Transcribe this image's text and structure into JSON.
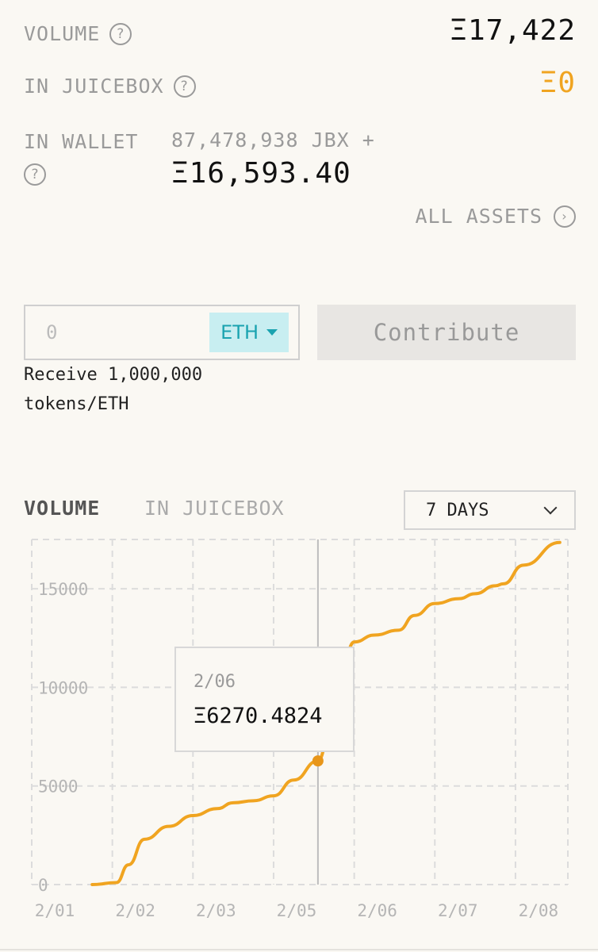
{
  "stats": {
    "volume_label": "VOLUME",
    "volume_value": "Ξ17,422",
    "in_juicebox_label": "IN JUICEBOX",
    "in_juicebox_value": "Ξ0",
    "in_wallet_label": "IN WALLET",
    "in_wallet_tokens": "87,478,938 JBX +",
    "in_wallet_eth": "Ξ16,593.40",
    "all_assets_label": "ALL ASSETS"
  },
  "pay": {
    "amount_placeholder": "0",
    "currency": "ETH",
    "contribute_label": "Contribute",
    "receive_line1": "Receive 1,000,000",
    "receive_line2": "tokens/ETH"
  },
  "chart_tabs": {
    "volume": "VOLUME",
    "in_juicebox": "IN JUICEBOX",
    "range": "7 DAYS"
  },
  "tooltip": {
    "date": "2/06",
    "value": "Ξ6270.4824"
  },
  "colors": {
    "accent_orange": "#f0a420",
    "accent_teal": "#1aa3b0"
  },
  "chart_data": {
    "type": "line",
    "title": "",
    "xlabel": "",
    "ylabel": "",
    "y_ticks": [
      0,
      5000,
      10000,
      15000
    ],
    "x_ticks": [
      "2/01",
      "2/02",
      "2/03",
      "2/05",
      "2/06",
      "2/07",
      "2/08"
    ],
    "ylim": [
      0,
      17500
    ],
    "grid": true,
    "series": [
      {
        "color": "#f0a420",
        "points": [
          [
            1.75,
            0
          ],
          [
            2.05,
            100
          ],
          [
            2.2,
            1000
          ],
          [
            2.4,
            2300
          ],
          [
            2.7,
            2950
          ],
          [
            3.0,
            3500
          ],
          [
            3.3,
            3850
          ],
          [
            3.5,
            4150
          ],
          [
            3.75,
            4250
          ],
          [
            4.0,
            4500
          ],
          [
            4.25,
            5300
          ],
          [
            4.55,
            6270
          ],
          [
            4.75,
            9000
          ],
          [
            4.9,
            11800
          ],
          [
            5.0,
            12300
          ],
          [
            5.25,
            12650
          ],
          [
            5.55,
            12900
          ],
          [
            5.75,
            13650
          ],
          [
            6.0,
            14250
          ],
          [
            6.3,
            14500
          ],
          [
            6.5,
            14750
          ],
          [
            6.75,
            15150
          ],
          [
            6.85,
            15250
          ],
          [
            7.1,
            16200
          ],
          [
            7.55,
            17350
          ]
        ]
      }
    ],
    "highlight": {
      "date": "2/06",
      "value": 6270.4824
    }
  }
}
